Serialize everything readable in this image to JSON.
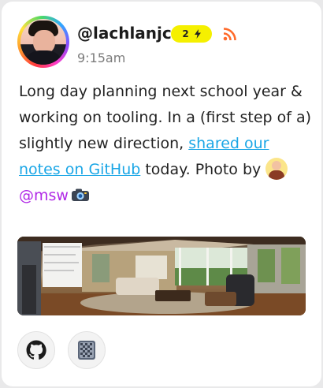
{
  "post": {
    "handle": "@lachlanjc",
    "badge_count": "2",
    "time": "9:15am",
    "text_1": "Long day planning next school year & working on tooling. In a (first step of a) slightly new direction, ",
    "link_text": "shared our notes on GitHub",
    "text_2": " today. Photo by ",
    "mention": "@msw"
  },
  "icons": {
    "avatar": "profile-photo",
    "badge": "lightning-icon",
    "feed": "rss-icon",
    "mention_avatar": "mini-avatar",
    "camera": "camera-emoji",
    "github": "github-icon",
    "app": "grid-app-icon"
  },
  "colors": {
    "badge": "#f5f000",
    "link": "#1aa6e6",
    "mention": "#b027e6",
    "rss": "#ff6a2a"
  }
}
